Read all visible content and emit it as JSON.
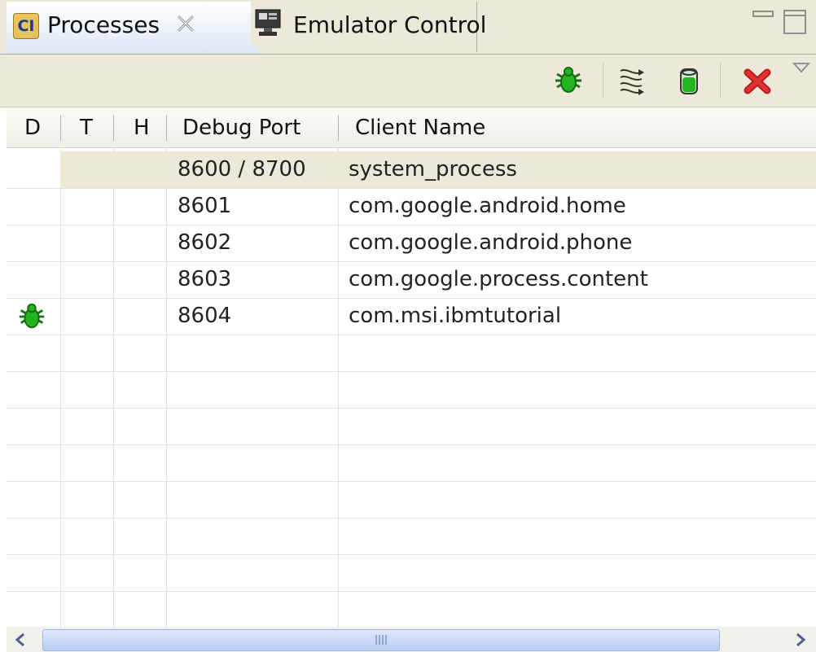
{
  "tabs": [
    {
      "label": "Processes",
      "icon": "ci-icon",
      "active": true
    },
    {
      "label": "Emulator Control",
      "icon": "emulator-icon",
      "active": false
    }
  ],
  "ci_icon_text": "CI",
  "toolbar": {
    "buttons": [
      "debug-process-icon",
      "update-threads-icon",
      "update-heap-icon",
      "stop-process-icon",
      "view-menu-icon"
    ]
  },
  "table": {
    "columns": [
      "D",
      "T",
      "H",
      "Debug Port",
      "Client Name"
    ],
    "rows": [
      {
        "debug": "",
        "port": "8600 / 8700",
        "name": "system_process",
        "selected": true
      },
      {
        "debug": "",
        "port": "8601",
        "name": "com.google.android.home"
      },
      {
        "debug": "",
        "port": "8602",
        "name": "com.google.android.phone"
      },
      {
        "debug": "",
        "port": "8603",
        "name": "com.google.process.content"
      },
      {
        "debug": "bug-icon",
        "port": "8604",
        "name": "com.msi.ibmtutorial"
      }
    ]
  },
  "colors": {
    "bug_green": "#22b51e",
    "stop_red": "#e03030",
    "selection": "#ece9d8"
  }
}
